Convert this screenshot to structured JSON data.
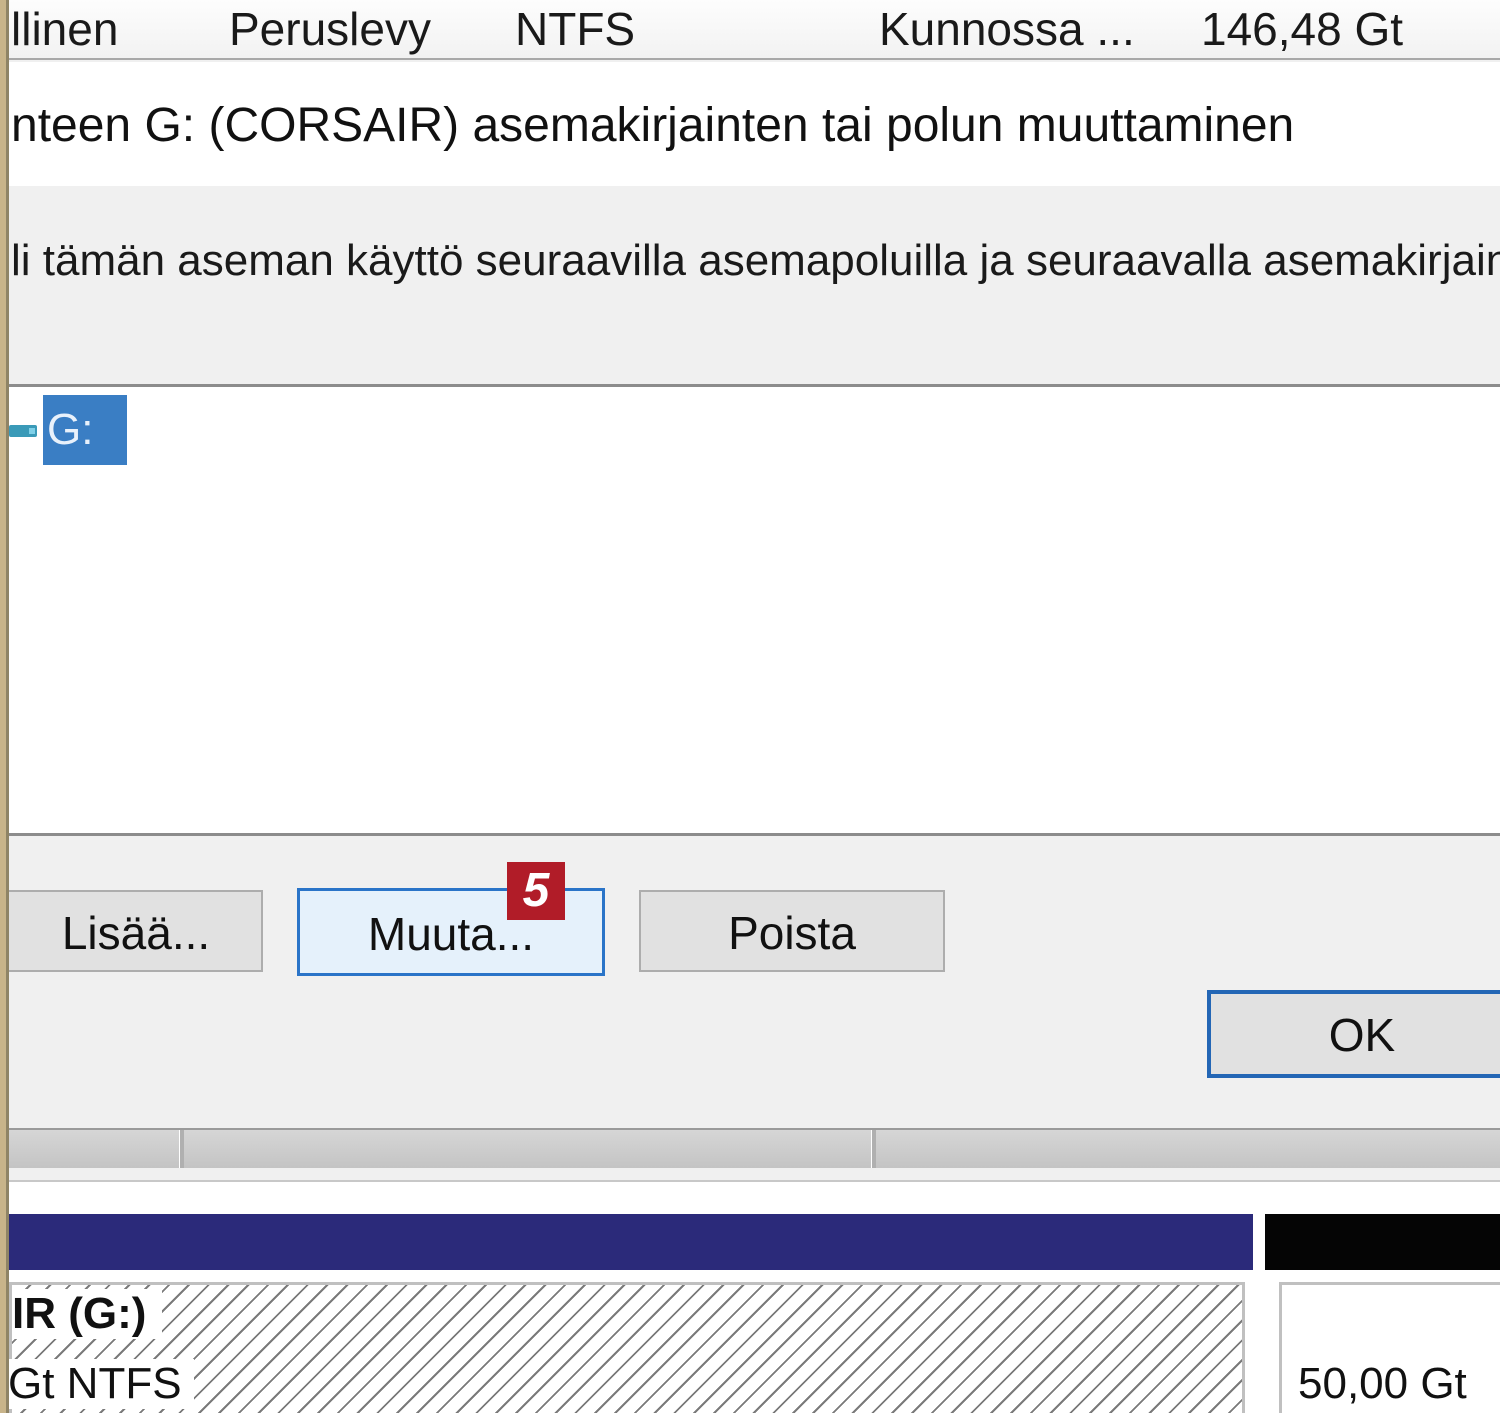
{
  "list_row": {
    "type": "llinen",
    "layout": "Peruslevy",
    "filesystem": "NTFS",
    "status": "Kunnossa ...",
    "capacity": "146,48 Gt"
  },
  "dialog": {
    "title": "nteen G: (CORSAIR) asemakirjainten tai polun muuttaminen",
    "description": "li tämän aseman käyttö seuraavilla asemapoluilla ja seuraavalla asemakirjain",
    "paths": [
      "G:"
    ],
    "buttons": {
      "add": "Lisää...",
      "change": "Muuta...",
      "remove": "Poista",
      "ok": "OK"
    },
    "step_badge": "5"
  },
  "disk_map": {
    "volume_label": "IR  (G:)",
    "volume_info": "Gt NTFS",
    "unallocated_size": "50,00 Gt",
    "colors": {
      "volume_bar": "#2b2a7a",
      "unallocated_bar": "#050505"
    }
  }
}
